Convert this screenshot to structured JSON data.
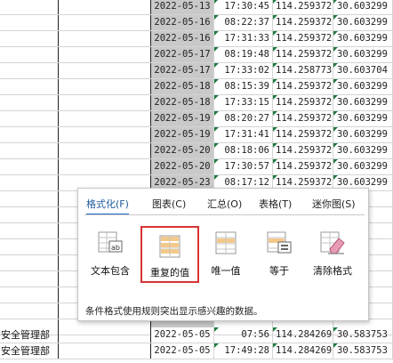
{
  "rows": [
    {
      "date": "2022-05-13",
      "time": "17:30:45",
      "lon": "114.259372",
      "lat": "30.603299"
    },
    {
      "date": "2022-05-16",
      "time": "08:22:37",
      "lon": "114.259372",
      "lat": "30.603299"
    },
    {
      "date": "2022-05-16",
      "time": "17:31:33",
      "lon": "114.259372",
      "lat": "30.603299"
    },
    {
      "date": "2022-05-17",
      "time": "08:19:48",
      "lon": "114.259372",
      "lat": "30.603299"
    },
    {
      "date": "2022-05-17",
      "time": "17:33:02",
      "lon": "114.258773",
      "lat": "30.603704"
    },
    {
      "date": "2022-05-18",
      "time": "08:15:39",
      "lon": "114.259372",
      "lat": "30.603299"
    },
    {
      "date": "2022-05-18",
      "time": "17:33:15",
      "lon": "114.259372",
      "lat": "30.603299"
    },
    {
      "date": "2022-05-19",
      "time": "08:20:27",
      "lon": "114.259372",
      "lat": "30.603299"
    },
    {
      "date": "2022-05-19",
      "time": "17:31:41",
      "lon": "114.259372",
      "lat": "30.603299"
    },
    {
      "date": "2022-05-20",
      "time": "08:18:06",
      "lon": "114.259372",
      "lat": "30.603299"
    },
    {
      "date": "2022-05-20",
      "time": "17:30:57",
      "lon": "114.259372",
      "lat": "30.603299"
    },
    {
      "date": "2022-05-23",
      "time": "08:17:12",
      "lon": "114.259372",
      "lat": "30.603299"
    }
  ],
  "bottom_rows": [
    {
      "dept": "安全管理部",
      "date": "2022-05-05",
      "time": "07:56",
      "lon": "114.284269",
      "lat": "30.583753"
    },
    {
      "dept": "安全管理部",
      "date": "2022-05-05",
      "time": "17:49:28",
      "lon": "114.284269",
      "lat": "30.583753"
    }
  ],
  "popup": {
    "tabs": [
      "格式化(F)",
      "图表(C)",
      "汇总(O)",
      "表格(T)",
      "迷你图(S)"
    ],
    "options": [
      "文本包含",
      "重复的值",
      "唯一值",
      "等于",
      "清除格式"
    ],
    "description": "条件格式使用规则突出显示感兴趣的数据。",
    "selected_option": "重复的值"
  },
  "colors": {
    "accent_tab": "#1e6fc9",
    "selection_border": "#d93434",
    "selected_column": "#c9c9c9",
    "error_triangle": "#1e7b3c"
  }
}
